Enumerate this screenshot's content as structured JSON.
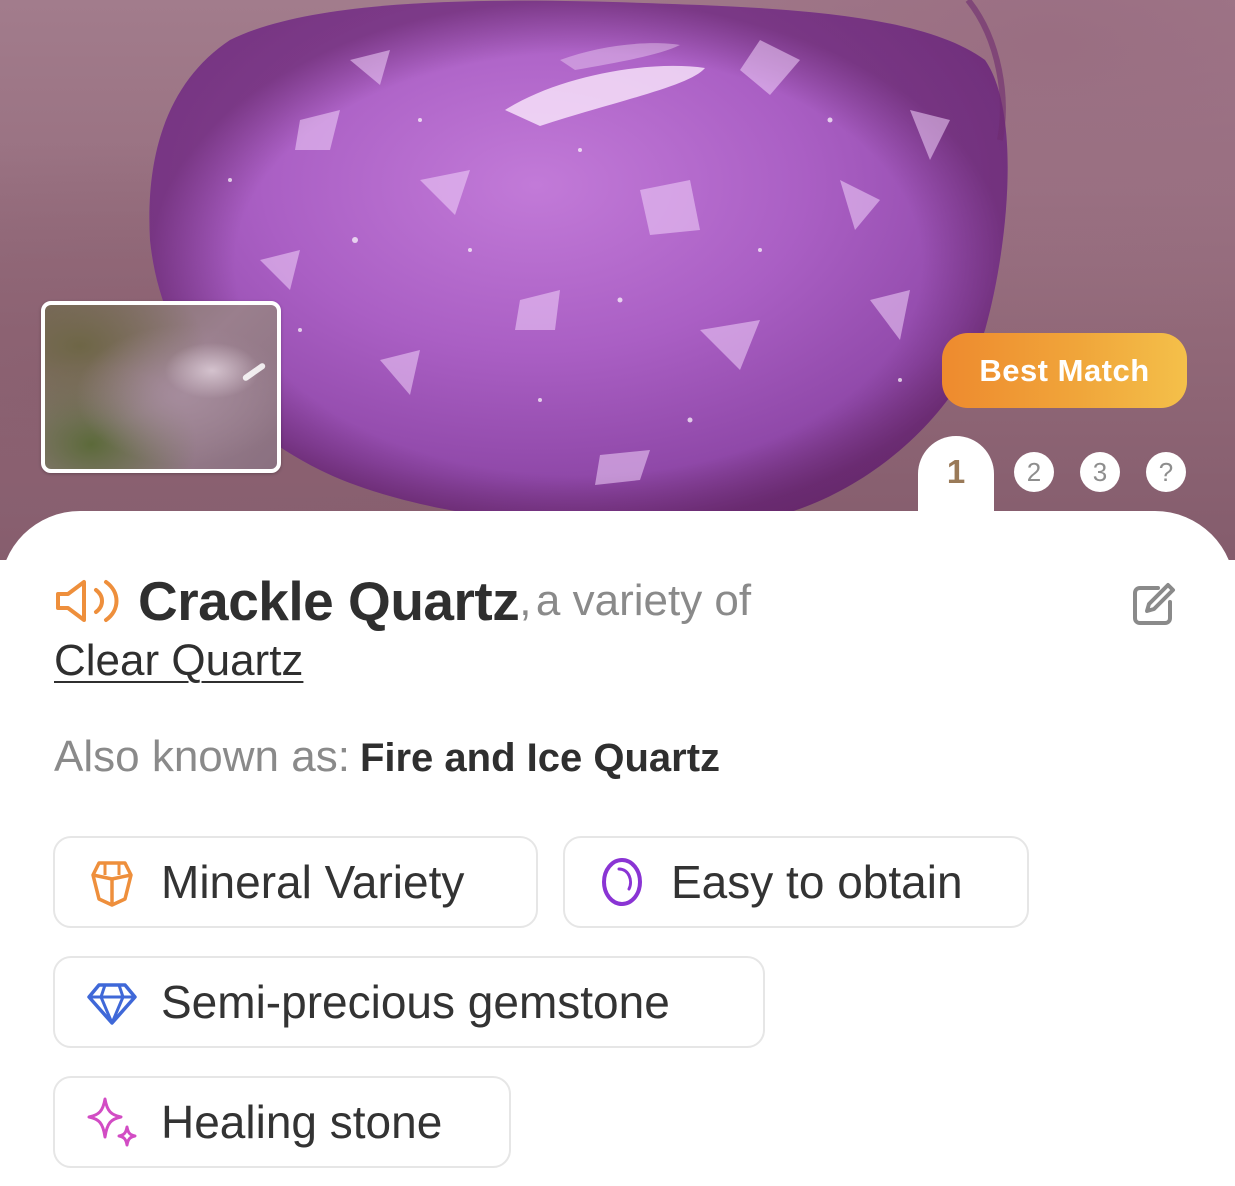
{
  "hero": {
    "badge": "Best Match",
    "tabs": [
      "1",
      "2",
      "3",
      "?"
    ]
  },
  "result": {
    "name": "Crackle Quartz",
    "comma": ",",
    "variety_suffix": "a variety of",
    "parent": "Clear Quartz",
    "aka_label": "Also known as:",
    "aka_value": "Fire and Ice Quartz"
  },
  "tags": [
    {
      "label": "Mineral Variety",
      "icon": "crystal-outline-icon",
      "color": "#ee8f3c"
    },
    {
      "label": "Easy to obtain",
      "icon": "stone-oval-icon",
      "color": "#8a34d4"
    },
    {
      "label": "Semi-precious gemstone",
      "icon": "diamond-icon",
      "color": "#3f68d8"
    },
    {
      "label": "Healing stone",
      "icon": "sparkle-icon",
      "color": "#d24cc4"
    }
  ],
  "colors": {
    "accent_orange": "#ee8a2e",
    "text_dark": "#2f2f2f",
    "text_muted": "#8a8a8a"
  }
}
